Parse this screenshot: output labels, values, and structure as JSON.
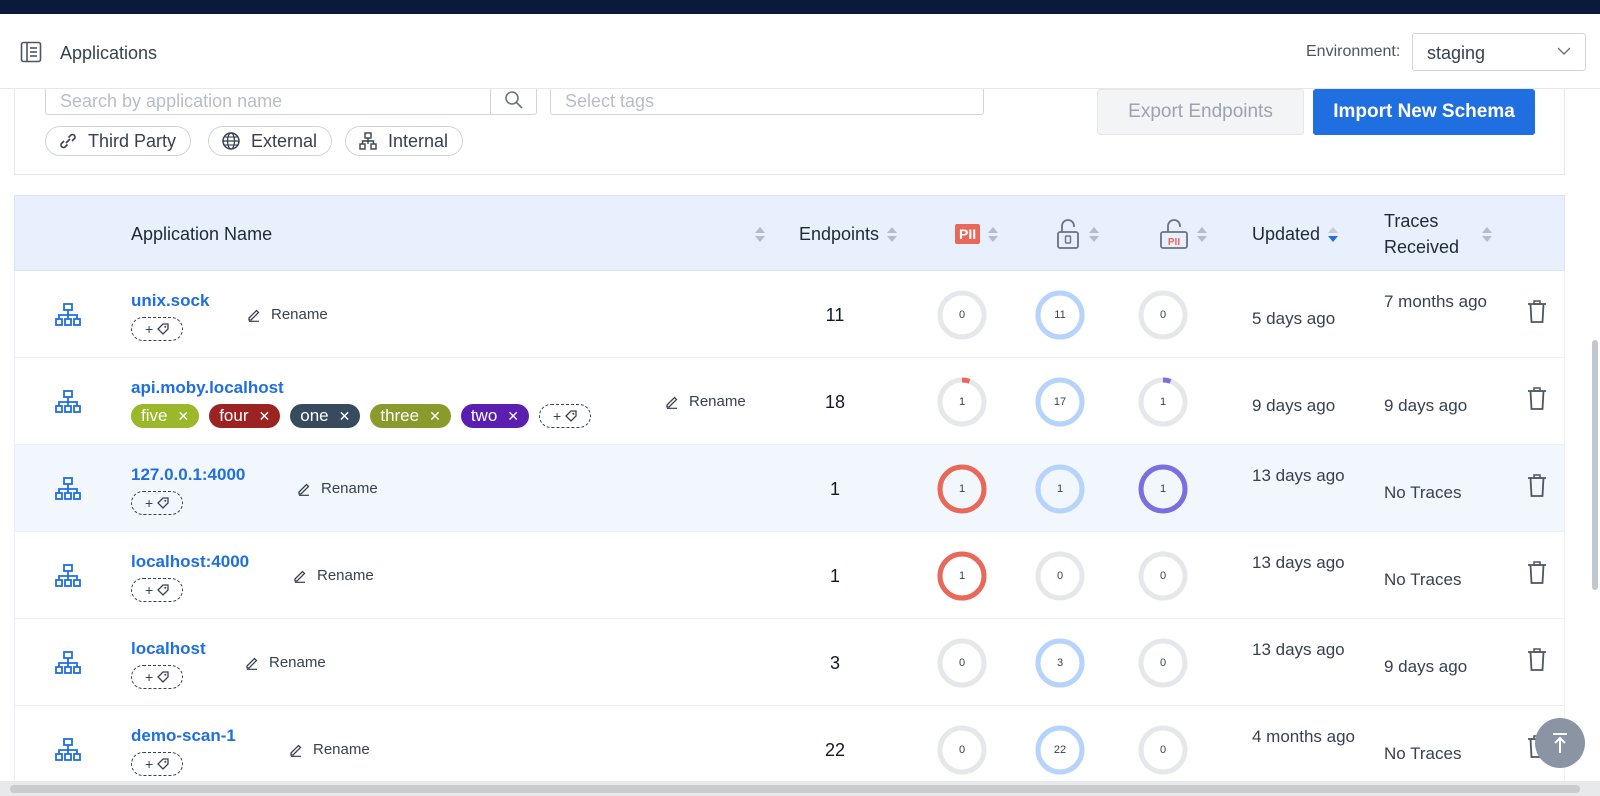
{
  "header": {
    "title": "Applications",
    "environment_label": "Environment:",
    "environment_value": "staging"
  },
  "filters": {
    "search_placeholder": "Search by application name",
    "tags_placeholder": "Select tags",
    "chips": [
      {
        "label": "Third Party",
        "icon": "link-icon"
      },
      {
        "label": "External",
        "icon": "globe-icon"
      },
      {
        "label": "Internal",
        "icon": "network-icon"
      }
    ],
    "export_label": "Export Endpoints",
    "import_label": "Import New Schema"
  },
  "table": {
    "columns": {
      "name": "Application Name",
      "endpoints": "Endpoints",
      "pii": "PII",
      "pii_unauth": "PII",
      "updated": "Updated",
      "traces": "Traces Received"
    },
    "rename_label": "Rename",
    "rows": [
      {
        "name": "unix.sock",
        "tags": [],
        "endpoints": "11",
        "pii": "0",
        "unauth": "11",
        "unauth_pii": "0",
        "updated": "5 days ago",
        "traces": "7 months ago"
      },
      {
        "name": "api.moby.localhost",
        "tags": [
          {
            "label": "five",
            "color": "#9ab82a"
          },
          {
            "label": "four",
            "color": "#9b2423"
          },
          {
            "label": "one",
            "color": "#374a5e"
          },
          {
            "label": "three",
            "color": "#8b9a2c"
          },
          {
            "label": "two",
            "color": "#5a1fb0"
          }
        ],
        "endpoints": "18",
        "pii": "1",
        "unauth": "17",
        "unauth_pii": "1",
        "updated": "9 days ago",
        "traces": "9 days ago"
      },
      {
        "name": "127.0.0.1:4000",
        "tags": [],
        "endpoints": "1",
        "pii": "1",
        "unauth": "1",
        "unauth_pii": "1",
        "updated": "13 days ago",
        "traces": "No Traces"
      },
      {
        "name": "localhost:4000",
        "tags": [],
        "endpoints": "1",
        "pii": "1",
        "unauth": "0",
        "unauth_pii": "0",
        "updated": "13 days ago",
        "traces": "No Traces"
      },
      {
        "name": "localhost",
        "tags": [],
        "endpoints": "3",
        "pii": "0",
        "unauth": "3",
        "unauth_pii": "0",
        "updated": "13 days ago",
        "traces": "9 days ago"
      },
      {
        "name": "demo-scan-1",
        "tags": [],
        "endpoints": "22",
        "pii": "0",
        "unauth": "22",
        "unauth_pii": "0",
        "updated": "4 months ago",
        "traces": "No Traces"
      }
    ]
  },
  "colors": {
    "accent": "#1f6fe0",
    "pii_red": "#e8685a",
    "unauth_blue": "#b6d4fb",
    "pii_purple": "#7b6ee0",
    "ring_grey": "#e5e7eb"
  }
}
